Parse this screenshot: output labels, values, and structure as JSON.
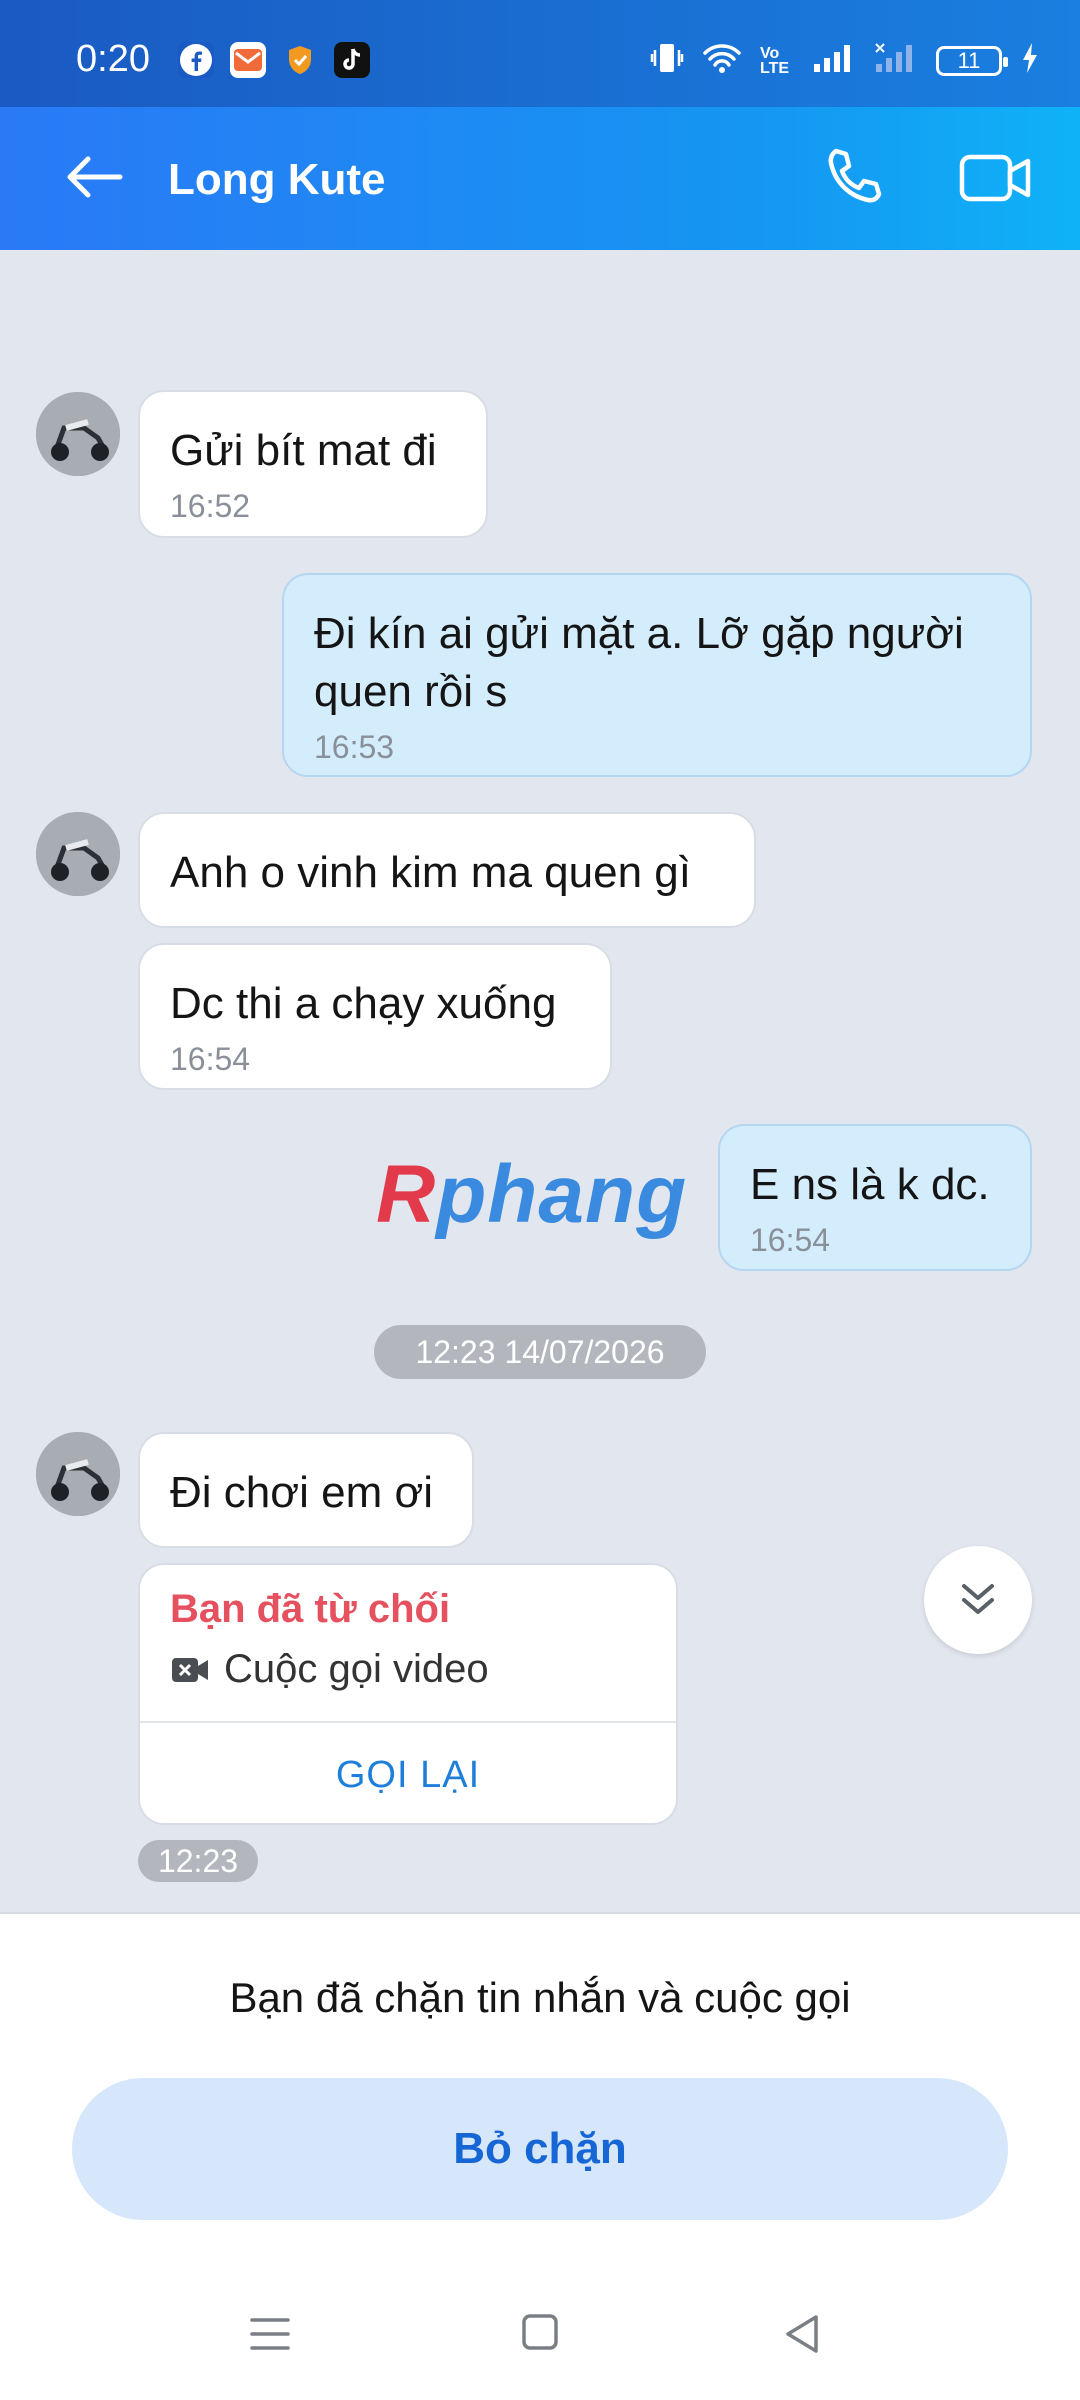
{
  "status_bar": {
    "time": "0:20",
    "apps": [
      "facebook-icon",
      "mail-app-icon",
      "shield-app-icon",
      "tiktok-icon"
    ],
    "volte": "Vo LTE",
    "battery": "11"
  },
  "header": {
    "contact_name": "Long Kute",
    "gradient_start": "#2a79f6",
    "gradient_end": "#0fb2f7"
  },
  "messages": [
    {
      "direction": "in",
      "text": "Gửi bít mat đi",
      "time": "16:52"
    },
    {
      "direction": "out",
      "text": "Đi kín ai gửi mặt a. Lỡ gặp người quen rồi s",
      "time": "16:53"
    },
    {
      "direction": "in",
      "text": "Anh o vinh kim ma quen gì",
      "time": ""
    },
    {
      "direction": "in",
      "text": "Dc thi a chạy xuống",
      "time": "16:54"
    },
    {
      "direction": "out",
      "text": "E ns là k dc.",
      "time": "16:54"
    },
    {
      "direction": "in",
      "text": "Đi chơi em ơi",
      "time": ""
    }
  ],
  "watermark": {
    "first": "R",
    "rest": "phang"
  },
  "date_separator": "12:23 14/07/2026",
  "call_card": {
    "status": "Bạn đã từ chối",
    "type": "Cuộc gọi video",
    "action": "GỌI LẠI",
    "time": "12:23"
  },
  "block_panel": {
    "message": "Bạn đã chặn tin nhắn và cuộc gọi",
    "unblock_label": "Bỏ chặn"
  },
  "colors": {
    "accent": "#1e7fdb",
    "declined": "#e5515f",
    "outgoing_bubble": "#d4edfd",
    "chat_bg": "#e2e7ef"
  }
}
